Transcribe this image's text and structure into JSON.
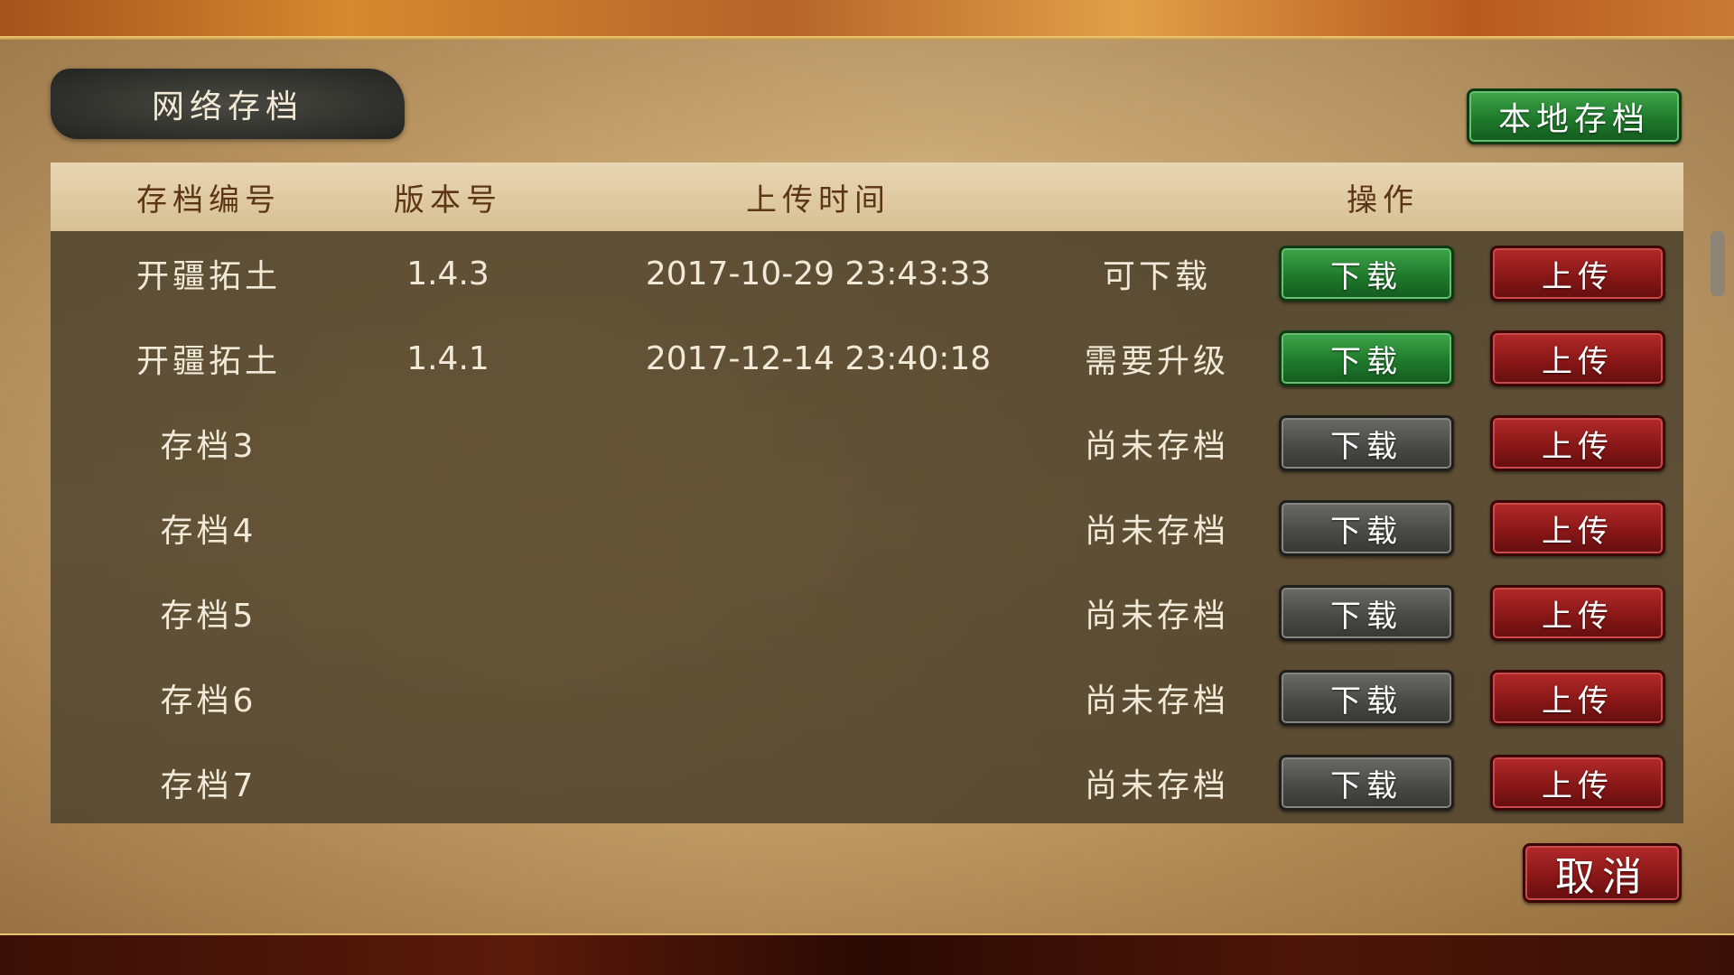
{
  "title": "网络存档",
  "local_save_button": "本地存档",
  "cancel_button": "取消",
  "table": {
    "headers": {
      "id": "存档编号",
      "version": "版本号",
      "upload_time": "上传时间",
      "action": "操作"
    },
    "download_label": "下载",
    "upload_label": "上传",
    "rows": [
      {
        "name": "开疆拓土",
        "version": "1.4.3",
        "time": "2017-10-29 23:43:33",
        "status": "可下载",
        "download_enabled": true
      },
      {
        "name": "开疆拓土",
        "version": "1.4.1",
        "time": "2017-12-14 23:40:18",
        "status": "需要升级",
        "download_enabled": true
      },
      {
        "name": "存档3",
        "version": "",
        "time": "",
        "status": "尚未存档",
        "download_enabled": false
      },
      {
        "name": "存档4",
        "version": "",
        "time": "",
        "status": "尚未存档",
        "download_enabled": false
      },
      {
        "name": "存档5",
        "version": "",
        "time": "",
        "status": "尚未存档",
        "download_enabled": false
      },
      {
        "name": "存档6",
        "version": "",
        "time": "",
        "status": "尚未存档",
        "download_enabled": false
      },
      {
        "name": "存档7",
        "version": "",
        "time": "",
        "status": "尚未存档",
        "download_enabled": false
      }
    ]
  },
  "colors": {
    "enabled_download": "#1f7a2c",
    "disabled_download": "#4a4a46",
    "upload": "#8a1717",
    "parchment": "#d9ba86",
    "table_body": "#5a4d34"
  }
}
